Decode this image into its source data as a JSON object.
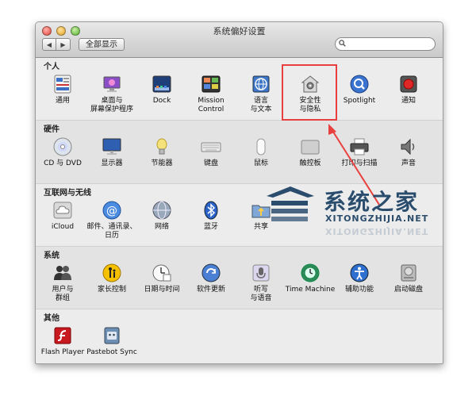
{
  "window": {
    "title": "系统偏好设置",
    "back_label": "◀",
    "forward_label": "▶",
    "show_all_label": "全部显示",
    "search_placeholder": ""
  },
  "sections": [
    {
      "label": "个人",
      "items": [
        {
          "label": "通用",
          "icon": "general-icon"
        },
        {
          "label": "桌面与\n屏幕保护程序",
          "icon": "desktop-screensaver-icon"
        },
        {
          "label": "Dock",
          "icon": "dock-icon"
        },
        {
          "label": "Mission\nControl",
          "icon": "mission-control-icon"
        },
        {
          "label": "语言\n与文本",
          "icon": "language-text-icon"
        },
        {
          "label": "安全性\n与隐私",
          "icon": "security-privacy-icon"
        },
        {
          "label": "Spotlight",
          "icon": "spotlight-icon"
        },
        {
          "label": "通知",
          "icon": "notifications-icon"
        }
      ]
    },
    {
      "label": "硬件",
      "items": [
        {
          "label": "CD 与 DVD",
          "icon": "cd-dvd-icon"
        },
        {
          "label": "显示器",
          "icon": "displays-icon"
        },
        {
          "label": "节能器",
          "icon": "energy-saver-icon"
        },
        {
          "label": "键盘",
          "icon": "keyboard-icon"
        },
        {
          "label": "鼠标",
          "icon": "mouse-icon"
        },
        {
          "label": "触控板",
          "icon": "trackpad-icon"
        },
        {
          "label": "打印与扫描",
          "icon": "print-scan-icon"
        },
        {
          "label": "声音",
          "icon": "sound-icon"
        }
      ]
    },
    {
      "label": "互联网与无线",
      "items": [
        {
          "label": "iCloud",
          "icon": "icloud-icon"
        },
        {
          "label": "邮件、通讯录、\n日历",
          "icon": "mail-contacts-calendars-icon"
        },
        {
          "label": "网络",
          "icon": "network-icon"
        },
        {
          "label": "蓝牙",
          "icon": "bluetooth-icon"
        },
        {
          "label": "共享",
          "icon": "sharing-icon"
        }
      ]
    },
    {
      "label": "系统",
      "items": [
        {
          "label": "用户与\n群组",
          "icon": "users-groups-icon"
        },
        {
          "label": "家长控制",
          "icon": "parental-controls-icon"
        },
        {
          "label": "日期与时间",
          "icon": "date-time-icon"
        },
        {
          "label": "软件更新",
          "icon": "software-update-icon"
        },
        {
          "label": "听写\n与语音",
          "icon": "dictation-speech-icon"
        },
        {
          "label": "Time Machine",
          "icon": "time-machine-icon"
        },
        {
          "label": "辅助功能",
          "icon": "accessibility-icon"
        },
        {
          "label": "启动磁盘",
          "icon": "startup-disk-icon"
        }
      ]
    },
    {
      "label": "其他",
      "items": [
        {
          "label": "Flash Player",
          "icon": "flash-player-icon"
        },
        {
          "label": "Pastebot Sync",
          "icon": "pastebot-sync-icon"
        }
      ]
    }
  ],
  "watermark": {
    "title": "系统之家",
    "url": "XITONGZHIJIA.NET"
  },
  "colors": {
    "highlight": "#e8403e",
    "watermark": "#2a4d6e"
  }
}
